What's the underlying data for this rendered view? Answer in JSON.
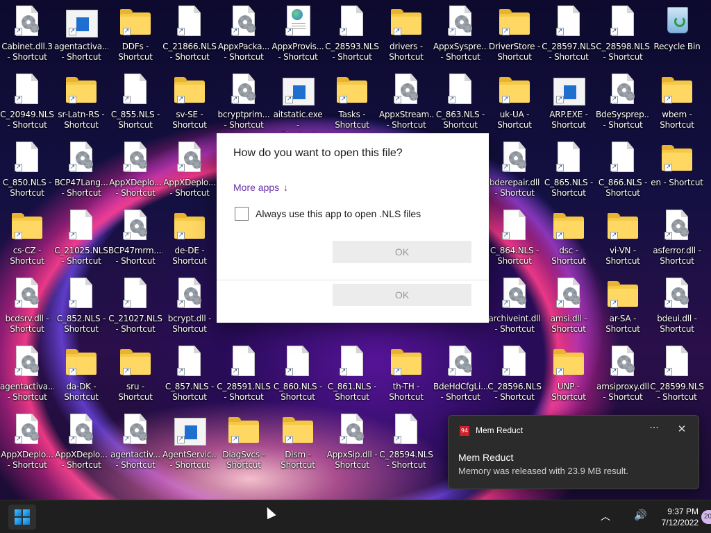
{
  "desktop": {
    "icons": [
      {
        "label": "Cabinet.dll.3\n- Shortcut",
        "type": "gear"
      },
      {
        "label": "agentactiva...\n- Shortcut",
        "type": "exe"
      },
      {
        "label": "DDFs -\nShortcut",
        "type": "folder"
      },
      {
        "label": "C_21866.NLS\n- Shortcut",
        "type": "doc"
      },
      {
        "label": "AppxPacka...\n- Shortcut",
        "type": "gear"
      },
      {
        "label": "AppxProvis...\n- Shortcut",
        "type": "web"
      },
      {
        "label": "C_28593.NLS\n- Shortcut",
        "type": "doc"
      },
      {
        "label": "drivers -\nShortcut",
        "type": "folder"
      },
      {
        "label": "AppxSyspre...\n- Shortcut",
        "type": "gear"
      },
      {
        "label": "DriverStore -\nShortcut",
        "type": "folder"
      },
      {
        "label": "C_28597.NLS\n- Shortcut",
        "type": "doc"
      },
      {
        "label": "C_28598.NLS\n- Shortcut",
        "type": "doc"
      },
      {
        "label": "Recycle Bin",
        "type": "bin"
      },
      {
        "label": "C_20949.NLS\n- Shortcut",
        "type": "doc"
      },
      {
        "label": "sr-Latn-RS -\nShortcut",
        "type": "folder"
      },
      {
        "label": "C_855.NLS -\nShortcut",
        "type": "doc"
      },
      {
        "label": "sv-SE -\nShortcut",
        "type": "folder"
      },
      {
        "label": "bcryptprim...\n- Shortcut",
        "type": "gear"
      },
      {
        "label": "aitstatic.exe -\nShortcut",
        "type": "exe"
      },
      {
        "label": "Tasks -\nShortcut",
        "type": "folder"
      },
      {
        "label": "AppxStream...\n- Shortcut",
        "type": "gear"
      },
      {
        "label": "C_863.NLS -\nShortcut",
        "type": "doc"
      },
      {
        "label": "uk-UA -\nShortcut",
        "type": "folder"
      },
      {
        "label": "ARP.EXE -\nShortcut",
        "type": "exe"
      },
      {
        "label": "BdeSysprep....\n- Shortcut",
        "type": "gear"
      },
      {
        "label": "wbem -\nShortcut",
        "type": "folder"
      },
      {
        "label": "C_850.NLS -\nShortcut",
        "type": "doc"
      },
      {
        "label": "BCP47Lang...\n- Shortcut",
        "type": "gear"
      },
      {
        "label": "AppXDeplo...\n- Shortcut",
        "type": "gear"
      },
      {
        "label": "AppXDeplo...\n- Shortcut",
        "type": "gear"
      },
      {
        "label": "",
        "type": "hidden"
      },
      {
        "label": "",
        "type": "hidden"
      },
      {
        "label": "",
        "type": "hidden"
      },
      {
        "label": "",
        "type": "hidden"
      },
      {
        "label": "",
        "type": "hidden"
      },
      {
        "label": "bderepair.dll\n- Shortcut",
        "type": "gear"
      },
      {
        "label": "C_865.NLS -\nShortcut",
        "type": "doc"
      },
      {
        "label": "C_866.NLS -\nShortcut",
        "type": "doc"
      },
      {
        "label": "en - Shortcut",
        "type": "folder"
      },
      {
        "label": "cs-CZ -\nShortcut",
        "type": "folder"
      },
      {
        "label": "C_21025.NLS\n- Shortcut",
        "type": "doc"
      },
      {
        "label": "BCP47mrm....\n- Shortcut",
        "type": "gear"
      },
      {
        "label": "de-DE -\nShortcut",
        "type": "folder"
      },
      {
        "label": "",
        "type": "hidden"
      },
      {
        "label": "",
        "type": "hidden"
      },
      {
        "label": "",
        "type": "hidden"
      },
      {
        "label": "",
        "type": "hidden"
      },
      {
        "label": "",
        "type": "hidden"
      },
      {
        "label": "C_864.NLS -\nShortcut",
        "type": "doc"
      },
      {
        "label": "dsc - Shortcut",
        "type": "folder"
      },
      {
        "label": "vi-VN -\nShortcut",
        "type": "folder"
      },
      {
        "label": "asferror.dll -\nShortcut",
        "type": "gear"
      },
      {
        "label": "bcdsrv.dll -\nShortcut",
        "type": "gear"
      },
      {
        "label": "C_852.NLS -\nShortcut",
        "type": "doc"
      },
      {
        "label": "C_21027.NLS\n- Shortcut",
        "type": "doc"
      },
      {
        "label": "bcrypt.dll -\nShortcut",
        "type": "gear"
      },
      {
        "label": "Shortcut",
        "type": "hidden"
      },
      {
        "label": "- Shortcut",
        "type": "hidden"
      },
      {
        "label": "Shortcut",
        "type": "hidden"
      },
      {
        "label": "Shortcut",
        "type": "hidden"
      },
      {
        "label": "archiveint.dll\n- Shortcut",
        "type": "gear"
      },
      {
        "label": "amsi.dll -\nShortcut",
        "type": "gear"
      },
      {
        "label": "ar-SA -\nShortcut",
        "type": "folder"
      },
      {
        "label": "bdeui.dll -\nShortcut",
        "type": "gear"
      },
      {
        "label": "agentactiva...\n- Shortcut",
        "type": "gear"
      },
      {
        "label": "da-DK -\nShortcut",
        "type": "folder"
      },
      {
        "label": "sru - Shortcut",
        "type": "folder"
      },
      {
        "label": "C_857.NLS -\nShortcut",
        "type": "doc"
      },
      {
        "label": "C_28591.NLS\n- Shortcut",
        "type": "doc"
      },
      {
        "label": "C_860.NLS -\nShortcut",
        "type": "doc"
      },
      {
        "label": "C_861.NLS -\nShortcut",
        "type": "doc"
      },
      {
        "label": "th-TH -\nShortcut",
        "type": "folder"
      },
      {
        "label": "BdeHdCfgLi...\n- Shortcut",
        "type": "gear"
      },
      {
        "label": "C_28596.NLS\n- Shortcut",
        "type": "doc"
      },
      {
        "label": "UNP -\nShortcut",
        "type": "folder"
      },
      {
        "label": "amsiproxy.dll\n- Shortcut",
        "type": "gear"
      },
      {
        "label": "C_28599.NLS\n- Shortcut",
        "type": "doc"
      },
      {
        "label": "AppXDeplo...\n- Shortcut",
        "type": "gear"
      },
      {
        "label": "AppXDeplo...\n- Shortcut",
        "type": "gear"
      },
      {
        "label": "agentactiv...\n- Shortcut",
        "type": "gear"
      },
      {
        "label": "AgentServic...\n- Shortcut",
        "type": "exe"
      },
      {
        "label": "DiagSvcs -\nShortcut",
        "type": "folder"
      },
      {
        "label": "Dism -\nShortcut",
        "type": "folder"
      },
      {
        "label": "AppxSip.dll -\nShortcut",
        "type": "gear"
      },
      {
        "label": "C_28594.NLS\n- Shortcut",
        "type": "doc"
      },
      {
        "label": "C_",
        "type": "hidden"
      }
    ]
  },
  "dialog": {
    "title": "How do you want to open this file?",
    "more_apps": "More apps",
    "more_apps_arrow": "↓",
    "always_label": "Always use this app to open .NLS files",
    "ok1": "OK",
    "ok2": "OK"
  },
  "toast": {
    "app_icon": "94",
    "app_name": "Mem Reduct",
    "more": "···",
    "close": "✕",
    "title": "Mem Reduct",
    "message": "Memory was released with 23.9 MB result."
  },
  "taskbar": {
    "chevron": "︿",
    "speaker": "🔊",
    "time": "9:37 PM",
    "date": "7/12/2022",
    "badge": "20"
  }
}
